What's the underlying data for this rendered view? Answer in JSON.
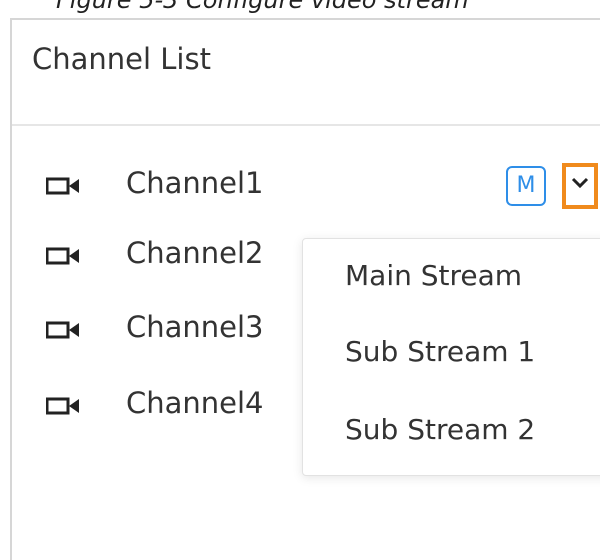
{
  "caption": "Figure 5-3 Configure video stream",
  "panel": {
    "title": "Channel List"
  },
  "channels": [
    {
      "label": "Channel1"
    },
    {
      "label": "Channel2"
    },
    {
      "label": "Channel3"
    },
    {
      "label": "Channel4"
    }
  ],
  "stream_badge": "M",
  "dropdown": {
    "options": [
      "Main Stream",
      "Sub Stream 1",
      "Sub Stream 2"
    ]
  },
  "colors": {
    "badge": "#2e8ee8",
    "highlight": "#f08a1c"
  },
  "icons": {
    "channel": "video-camera-icon",
    "toggle": "chevron-down-icon"
  }
}
